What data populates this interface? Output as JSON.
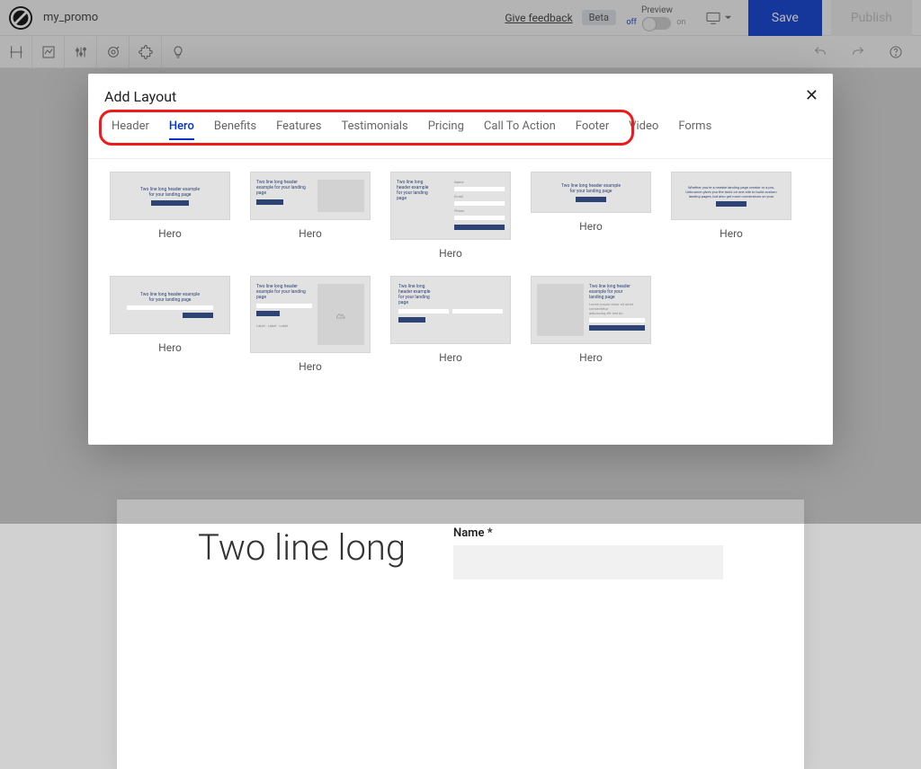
{
  "topbar": {
    "page_name": "my_promo",
    "feedback": "Give feedback",
    "beta": "Beta",
    "preview": "Preview",
    "off": "off",
    "on": "on",
    "save": "Save",
    "publish": "Publish"
  },
  "canvas": {
    "heading": "Two line long",
    "name_label": "Name *"
  },
  "modal": {
    "title": "Add Layout",
    "tabs": [
      "Header",
      "Hero",
      "Benefits",
      "Features",
      "Testimonials",
      "Pricing",
      "Call To Action",
      "Footer",
      "Video",
      "Forms"
    ],
    "active_tab": "Hero",
    "items": [
      {
        "label": "Hero",
        "variant": "centered"
      },
      {
        "label": "Hero",
        "variant": "left-media"
      },
      {
        "label": "Hero",
        "variant": "left-form"
      },
      {
        "label": "Hero",
        "variant": "centered-narrow"
      },
      {
        "label": "Hero",
        "variant": "paragraph"
      },
      {
        "label": "Hero",
        "variant": "centered-tall"
      },
      {
        "label": "Hero",
        "variant": "left-media-tall"
      },
      {
        "label": "Hero",
        "variant": "two-col-form"
      },
      {
        "label": "Hero",
        "variant": "right-form"
      }
    ]
  }
}
